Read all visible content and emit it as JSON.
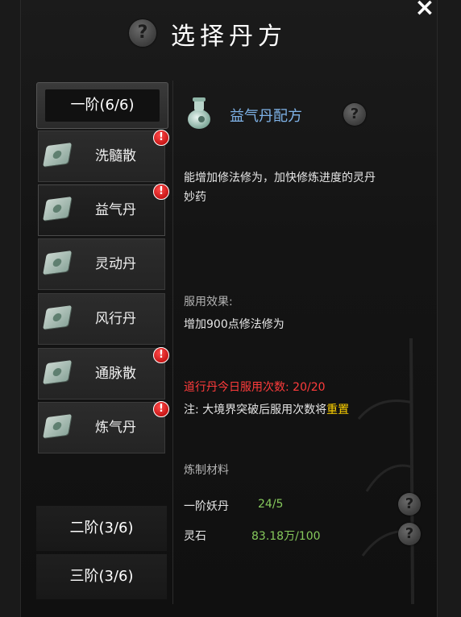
{
  "header": {
    "title": "选择丹方",
    "close": "×",
    "help": "?"
  },
  "sidebar": {
    "tier1": "一阶(6/6)",
    "recipes": [
      {
        "label": "洗髓散",
        "alert": true
      },
      {
        "label": "益气丹",
        "alert": true,
        "selected": true
      },
      {
        "label": "灵动丹",
        "alert": false
      },
      {
        "label": "风行丹",
        "alert": false
      },
      {
        "label": "通脉散",
        "alert": true
      },
      {
        "label": "炼气丹",
        "alert": true
      }
    ],
    "tier2": "二阶(3/6)",
    "tier3": "三阶(3/6)"
  },
  "detail": {
    "name": "益气丹配方",
    "description_line1": "能增加修法修为，加快修炼进度的灵丹",
    "description_line2": "妙药",
    "effect_label": "服用效果:",
    "effect_text": "增加900点修法修为",
    "daily_limit_label": "道行丹今日服用次数: ",
    "daily_limit_value": "20/20",
    "note_prefix": "注: 大境界突破后服用次数将",
    "note_highlight": "重置",
    "materials_label": "炼制材料",
    "materials": [
      {
        "name": "一阶妖丹",
        "amount": "24/5"
      },
      {
        "name": "灵石",
        "amount": "83.18万/100"
      }
    ]
  },
  "colors": {
    "accent_blue": "#7fb3e8",
    "alert_red": "#ff3b3b",
    "highlight_yellow": "#ffd200",
    "amount_green": "#86c95c"
  }
}
